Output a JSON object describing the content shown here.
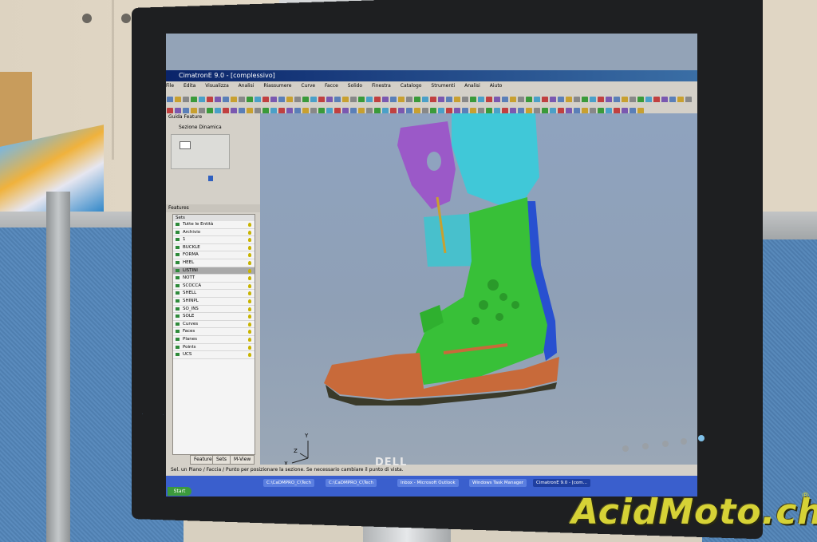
{
  "window": {
    "title": "CimatronE 9.0 - [complessivo]"
  },
  "menu": [
    "File",
    "Edita",
    "Visualizza",
    "Analisi",
    "Riassumere",
    "Curve",
    "Facce",
    "Solido",
    "Finestra",
    "Catalogo",
    "Strumenti",
    "Analisi",
    "Aiuto"
  ],
  "left_panel": {
    "guide_header": "Guida Feature",
    "guide_item": "Sezione Dinamica",
    "features_header": "Features",
    "list_header": "Sets",
    "items": [
      {
        "label": "Tutte le Entità",
        "selected": false
      },
      {
        "label": "Archivio",
        "selected": false
      },
      {
        "label": "1",
        "selected": false
      },
      {
        "label": "BUCKLE",
        "selected": false
      },
      {
        "label": "FORMA",
        "selected": false
      },
      {
        "label": "HEEL",
        "selected": false
      },
      {
        "label": "LISTINI",
        "selected": true
      },
      {
        "label": "NOTT",
        "selected": false
      },
      {
        "label": "SCOCCA",
        "selected": false
      },
      {
        "label": "SHELL",
        "selected": false
      },
      {
        "label": "SHINPL",
        "selected": false
      },
      {
        "label": "SO_INS",
        "selected": false
      },
      {
        "label": "SOLE",
        "selected": false
      },
      {
        "label": "Curves",
        "selected": false
      },
      {
        "label": "Faces",
        "selected": false
      },
      {
        "label": "Planes",
        "selected": false
      },
      {
        "label": "Points",
        "selected": false
      },
      {
        "label": "UCS",
        "selected": false
      }
    ],
    "tabs": [
      "Features",
      "Sets",
      "M-View"
    ]
  },
  "viewport": {
    "axis_labels": {
      "x": "X",
      "y": "Y",
      "z": "Z"
    }
  },
  "status": {
    "text": "Sel. un Piano / Faccia / Punto per posizionare la sezione. Se necessario cambiare il punto di vista."
  },
  "taskbar": {
    "start_label": "Start",
    "items": [
      "C:\\CaDMPRO_C\\Tech",
      "C:\\CaDMPRO_C\\Tech",
      "Inbox - Microsoft Outlook",
      "Windows Task Manager",
      "CimatronE 9.0 - [com..."
    ]
  },
  "monitor_brand": "DELL",
  "watermark": "AcidMoto.ch",
  "watermark_mark": "®",
  "colors": {
    "boot_purple": "#9b59c8",
    "boot_cyan": "#40c8d8",
    "boot_green": "#38c038",
    "boot_brown": "#c86a3a",
    "boot_blue": "#2850d0",
    "watermark": "#d6d236"
  }
}
